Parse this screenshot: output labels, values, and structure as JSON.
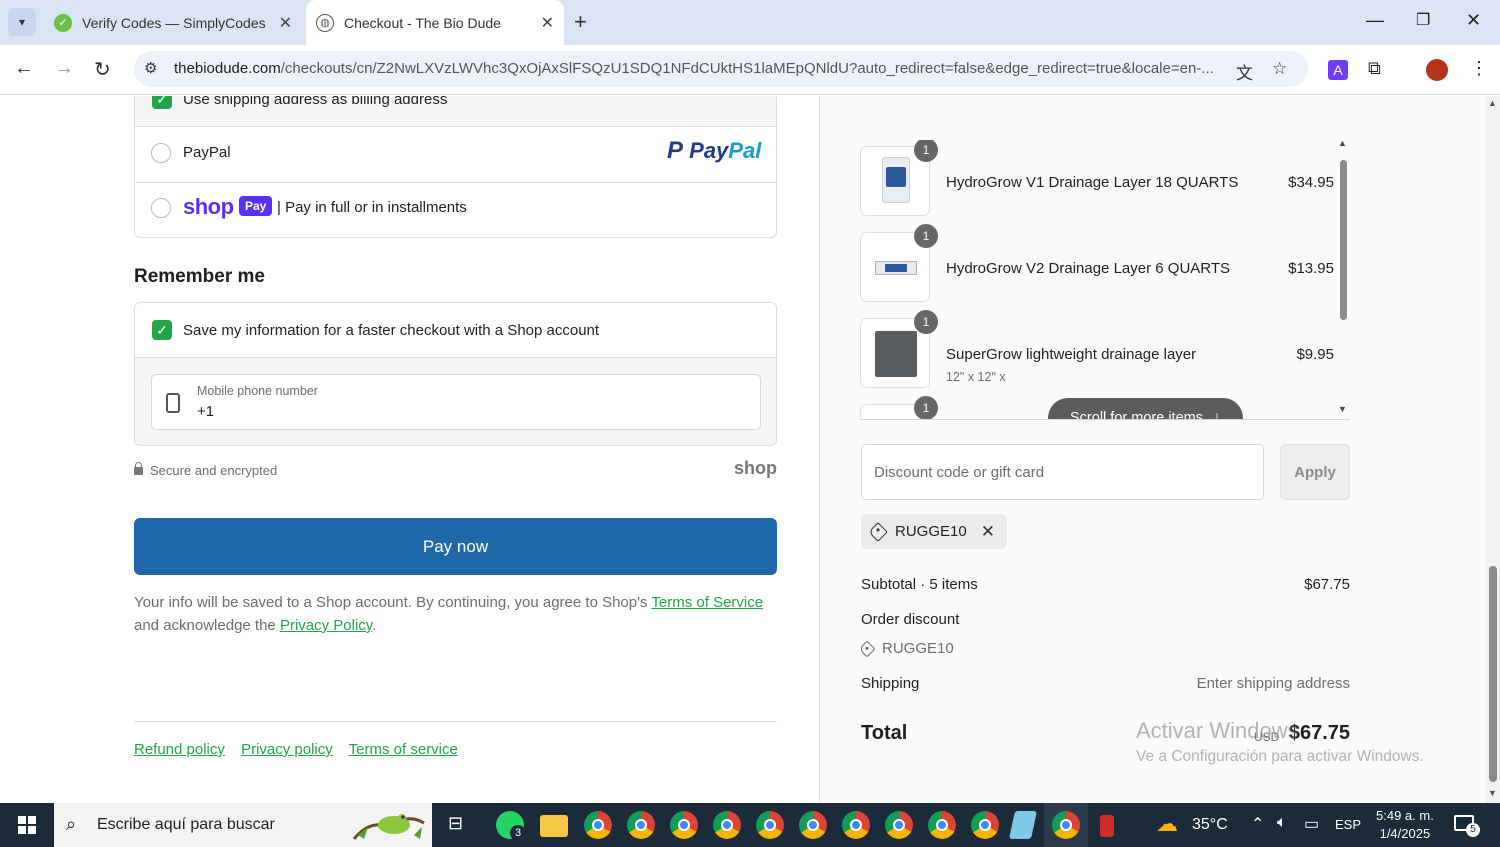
{
  "browser": {
    "tabs": [
      {
        "title": "Verify Codes — SimplyCodes",
        "active": false
      },
      {
        "title": "Checkout - The Bio Dude",
        "active": true
      }
    ],
    "url_domain": "thebiodude.com",
    "url_path": "/checkouts/cn/Z2NwLXVzLWVhc3QxOjAxSlFSQzU1SDQ1NFdCUktHS1laMEpQNldU?auto_redirect=false&edge_redirect=true&locale=en-..."
  },
  "payment": {
    "billing_label": "Use shipping address as billing address",
    "paypal_label": "PayPal",
    "paypal_logo_a": "Pay",
    "paypal_logo_b": "Pal",
    "shop_word": "shop",
    "shop_badge": "Pay",
    "shop_pay_text": "| Pay in full or in installments"
  },
  "remember": {
    "title": "Remember me",
    "save_label": "Save my information for a faster checkout with a Shop account",
    "phone_label": "Mobile phone number",
    "phone_value": "+1",
    "secure_text": "Secure and encrypted",
    "shop_mark": "shop"
  },
  "pay_now_label": "Pay now",
  "consent": {
    "part1": "Your info will be saved to a Shop account. By continuing, you agree to Shop's ",
    "terms_link": "Terms of Service",
    "part2": " and acknowledge the ",
    "privacy_link": "Privacy Policy",
    "part3": "."
  },
  "footer_links": [
    "Refund policy",
    "Privacy policy",
    "Terms of service"
  ],
  "order": {
    "items": [
      {
        "qty": "1",
        "title": "HydroGrow V1 Drainage Layer 18 QUARTS",
        "variant": "",
        "price": "$34.95"
      },
      {
        "qty": "1",
        "title": "HydroGrow V2 Drainage Layer 6 QUARTS",
        "variant": "",
        "price": "$13.95"
      },
      {
        "qty": "1",
        "title": "SuperGrow lightweight drainage layer",
        "variant": "12\" x 12\" x",
        "price": "$9.95"
      },
      {
        "qty": "1",
        "title": "",
        "variant": "",
        "price": ""
      }
    ],
    "scroll_pill": "Scroll for more items",
    "discount_placeholder": "Discount code or gift card",
    "apply_label": "Apply",
    "applied_code": "RUGGE10",
    "subtotal_label": "Subtotal · 5 items",
    "subtotal_value": "$67.75",
    "order_discount_label": "Order discount",
    "discount_code": "RUGGE10",
    "shipping_label": "Shipping",
    "shipping_value": "Enter shipping address",
    "total_label": "Total",
    "total_currency": "USD",
    "total_value": "$67.75"
  },
  "watermark": {
    "line1": "Activar Windows",
    "line2": "Ve a Configuración para activar Windows."
  },
  "taskbar": {
    "search_placeholder": "Escribe aquí para buscar",
    "whatsapp_badge": "3",
    "temperature": "35°C",
    "language": "ESP",
    "time": "5:49 a. m.",
    "date": "1/4/2025",
    "notifications": "5"
  },
  "colors": {
    "accent_green": "#22a447",
    "pay_button": "#1f68a9",
    "shop_purple": "#5a31f4"
  }
}
